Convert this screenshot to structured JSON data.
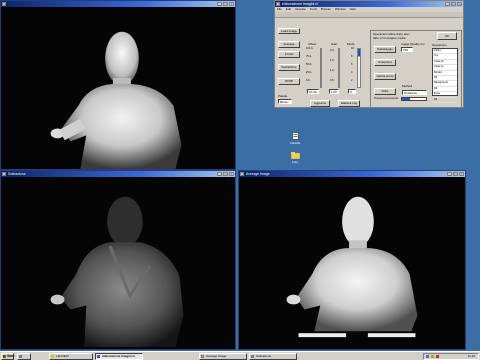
{
  "windows": {
    "top_left": {
      "title": ""
    },
    "bottom_left": {
      "title": "Sottrazione"
    },
    "bottom_right": {
      "title": "Average Image"
    },
    "panel": {
      "title": "elaborazione Imagini.vi"
    }
  },
  "panel": {
    "menu": [
      "File",
      "Edit",
      "Operate",
      "Tools",
      "Browse",
      "Window",
      "Help"
    ],
    "load_image_label": "Load Image",
    "buttons": {
      "average": "Average",
      "fondo": "Fondo",
      "sottrazione": "Sottrazione",
      "stop": "STOP",
      "aggiorna": "Aggiorna",
      "elabora_img": "Elabora img",
      "salvataggio": "Salvataggio",
      "immagine": "Anteprima",
      "carica_punto": "Carica punto",
      "filtra": "Filtra",
      "ok": "OK"
    },
    "offset_label": "Offset",
    "gain_label": "Gain",
    "mode_label": "Mode",
    "offset_values": [
      "100,0-",
      "75,0-",
      "50,0-",
      "25,0-",
      "0,0-"
    ],
    "gain_values": [
      "2,0-",
      "1,5-",
      "1,0-",
      "0,5-"
    ],
    "mode_values": [
      "10",
      "8",
      "6",
      "4",
      "2"
    ],
    "offset_field": "10,00",
    "gain_field": "1,00",
    "mode_field": "0",
    "palette_label": "Palette",
    "palette_value": "Binary",
    "path_label": "path",
    "note_text": "Operazioni attive dopo aver fatto un'immagine media",
    "image_quality_label": "Image Quality (no",
    "image_quality_value": "750",
    "method_label": "Method",
    "method_value": "Gradiente",
    "progress_label": "Powered percento",
    "progress_value": 0.35,
    "list_header": "Operations",
    "list_items": [
      "Alpha",
      "Top",
      "Clear dx",
      "Clear sx",
      "Border",
      "Dil",
      "Background",
      "Dil",
      "Erosi",
      "Dil"
    ]
  },
  "desktop_icons": [
    {
      "label": "Cartella",
      "icon": "file-icon"
    },
    {
      "label": "Foto",
      "icon": "folder-icon"
    }
  ],
  "taskbar": {
    "start_label": "Start",
    "items": [
      {
        "label": "",
        "icon": "app-icon"
      },
      {
        "label": "LabVIEW",
        "icon": "labview-icon"
      },
      {
        "label": "elaborazione Imagini.vi",
        "icon": "vi-icon",
        "active": true
      },
      {
        "label": "Average Image",
        "icon": "image-icon"
      },
      {
        "label": "Sottrazione",
        "icon": "image-icon"
      }
    ],
    "clock": "11.26"
  }
}
